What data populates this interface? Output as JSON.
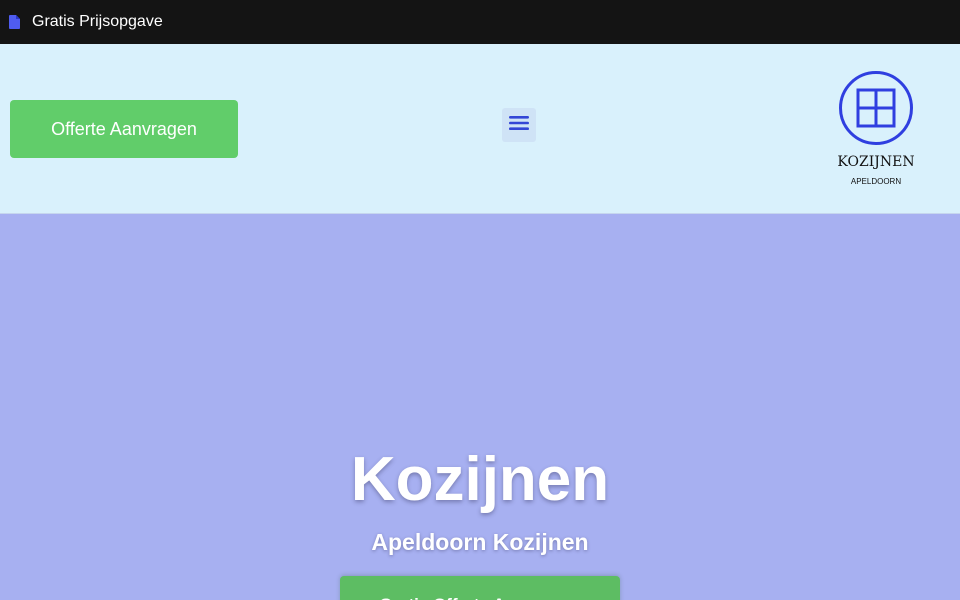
{
  "tab": {
    "icon": "document-icon",
    "title": "Gratis Prijsopgave"
  },
  "header": {
    "quote_button": "Offerte Aanvragen",
    "menu_icon": "hamburger-menu-icon",
    "logo": {
      "icon": "window-frame-icon",
      "brand": "KOZIJNEN",
      "sub": "APELDOORN"
    }
  },
  "hero": {
    "title": "Kozijnen",
    "subtitle": "Apeldoorn Kozijnen",
    "cta_button": "Gratis Offerte Aanvragen"
  },
  "colors": {
    "topbar": "#141414",
    "header_bg": "#d9f1fc",
    "hero_bg": "#a7b0f1",
    "button_green": "#61cd6a",
    "logo_blue": "#2f3fe0"
  }
}
